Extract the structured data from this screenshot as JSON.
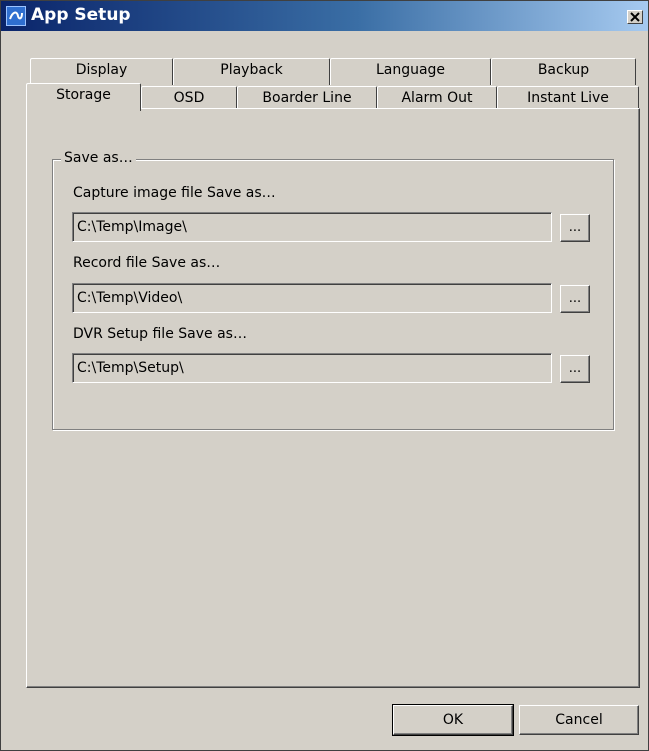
{
  "window": {
    "title": "App Setup"
  },
  "tabs": {
    "back_row": [
      {
        "label": "Display"
      },
      {
        "label": "Playback"
      },
      {
        "label": "Language"
      },
      {
        "label": "Backup"
      }
    ],
    "front_row": [
      {
        "label": "Storage",
        "active": true
      },
      {
        "label": "OSD"
      },
      {
        "label": "Boarder Line"
      },
      {
        "label": "Alarm Out"
      },
      {
        "label": "Instant Live"
      }
    ]
  },
  "storage": {
    "group_label": "Save as…",
    "capture": {
      "label": "Capture image file Save as…",
      "value": "C:\\Temp\\Image\\",
      "browse_label": "..."
    },
    "record": {
      "label": "Record file Save as…",
      "value": "C:\\Temp\\Video\\",
      "browse_label": "..."
    },
    "setup": {
      "label": "DVR Setup file Save as…",
      "value": "C:\\Temp\\Setup\\",
      "browse_label": "..."
    }
  },
  "buttons": {
    "ok": "OK",
    "cancel": "Cancel"
  },
  "icons": {
    "app": "app-swirl-icon",
    "close": "close-icon"
  },
  "colors": {
    "titlebar_start": "#0a246a",
    "titlebar_end": "#a6caf0",
    "face": "#d4d0c8"
  }
}
